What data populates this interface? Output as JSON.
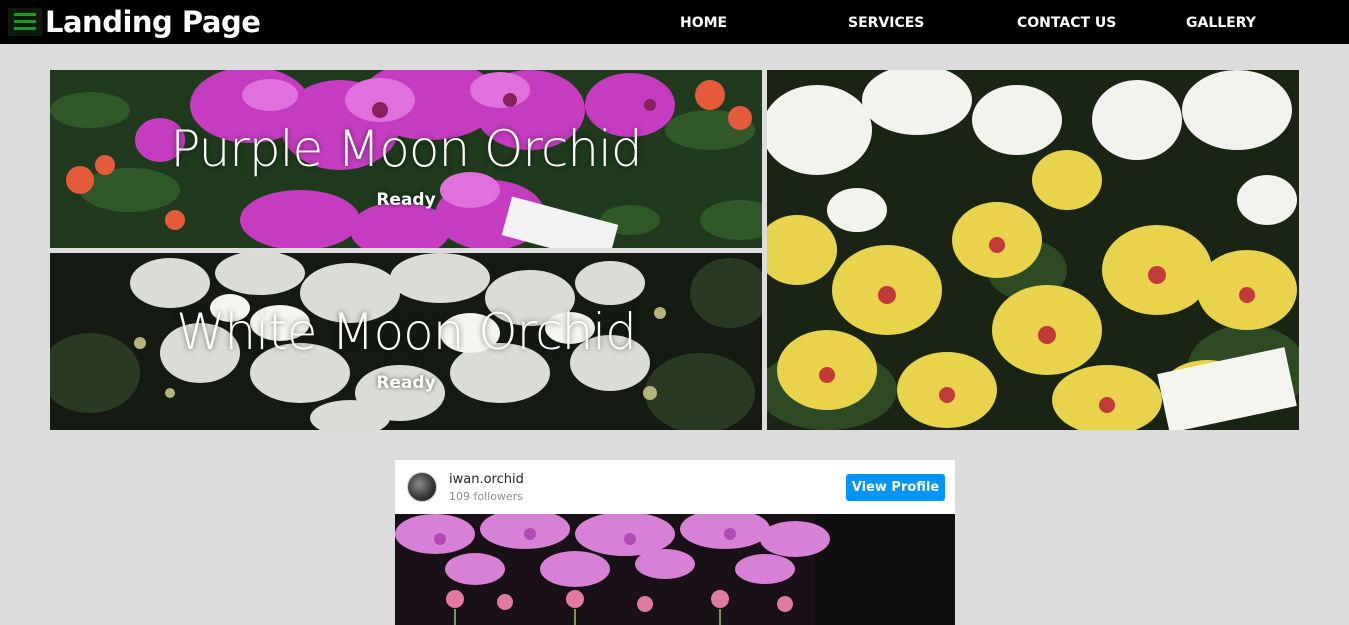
{
  "header": {
    "brand": "Landing Page",
    "menu_icon": "hamburger-menu-icon",
    "nav": [
      "HOME",
      "SERVICES",
      "CONTACT US",
      "GALLERY"
    ]
  },
  "gallery": {
    "tiles": [
      {
        "title": "Purple Moon Orchid",
        "subtitle": "Ready"
      },
      {
        "title": "White Moon Orchid",
        "subtitle": "Ready"
      },
      {
        "title": "",
        "subtitle": ""
      }
    ]
  },
  "instagram": {
    "username": "iwan.orchid",
    "followers": "109 followers",
    "button": "View Profile"
  },
  "colors": {
    "navbar": "#000000",
    "background": "#dcdcdc",
    "menu_icon": "#1f9a1f",
    "button": "#0095f6"
  }
}
